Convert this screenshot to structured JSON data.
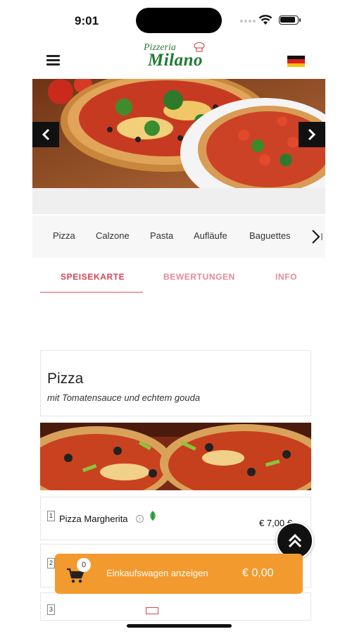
{
  "status": {
    "time": "9:01"
  },
  "header": {
    "logo_line1": "Pizzeria",
    "logo_line2": "Milano",
    "language": "DE",
    "flag_colors": [
      "#111111",
      "#dd1f1f",
      "#f4c20d"
    ]
  },
  "categories": [
    "Pizza",
    "Calzone",
    "Pasta",
    "Aufläufe",
    "Baguettes"
  ],
  "tabs": [
    {
      "label": "SPEISEKARTE",
      "active": true
    },
    {
      "label": "BEWERTUNGEN",
      "active": false
    },
    {
      "label": "INFO",
      "active": false
    }
  ],
  "section": {
    "title": "Pizza",
    "subtitle": "mit Tomatensauce und echtem gouda"
  },
  "items": [
    {
      "number": "1",
      "name": "Pizza Margherita",
      "price": "€ 7,00 €"
    },
    {
      "number": "2"
    },
    {
      "number": "3"
    }
  ],
  "cart": {
    "count": "0",
    "label": "Einkaufswagen anzeigen",
    "total": "€ 0,00"
  },
  "colors": {
    "accent": "#d6455a",
    "cart": "#f39a2e",
    "logo_green": "#1f7a33"
  }
}
